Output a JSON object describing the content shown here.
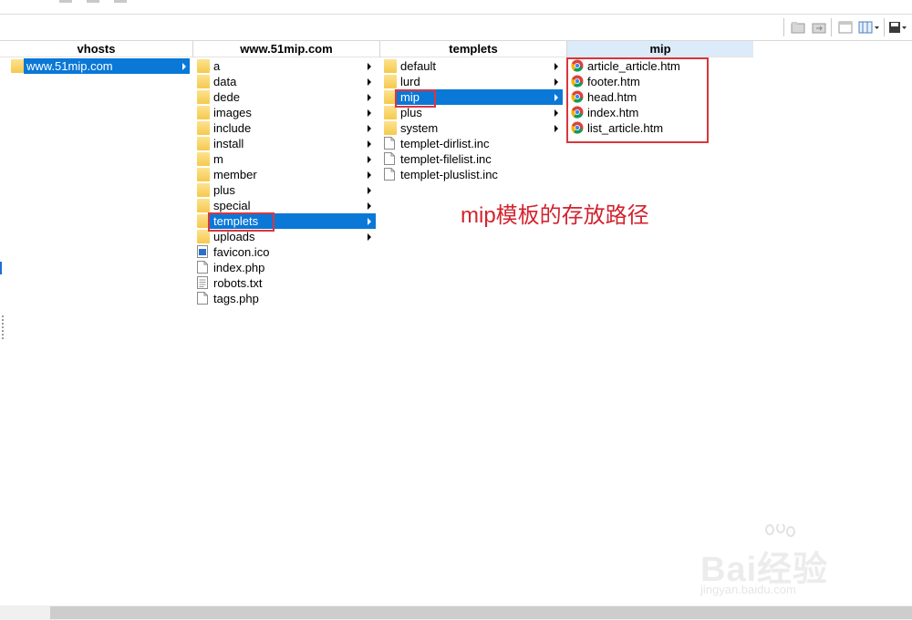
{
  "columns": [
    {
      "header": "vhosts",
      "items": [
        {
          "label": "www.51mip.com",
          "icon": "folder-icon",
          "arrow": true,
          "selected": true
        }
      ]
    },
    {
      "header": "www.51mip.com",
      "items": [
        {
          "label": "a",
          "icon": "folder-icon",
          "arrow": true
        },
        {
          "label": "data",
          "icon": "folder-icon",
          "arrow": true
        },
        {
          "label": "dede",
          "icon": "folder-icon",
          "arrow": true
        },
        {
          "label": "images",
          "icon": "folder-icon",
          "arrow": true
        },
        {
          "label": "include",
          "icon": "folder-icon",
          "arrow": true
        },
        {
          "label": "install",
          "icon": "folder-icon",
          "arrow": true
        },
        {
          "label": "m",
          "icon": "folder-icon",
          "arrow": true
        },
        {
          "label": "member",
          "icon": "folder-icon",
          "arrow": true
        },
        {
          "label": "plus",
          "icon": "folder-icon",
          "arrow": true
        },
        {
          "label": "special",
          "icon": "folder-icon",
          "arrow": true
        },
        {
          "label": "templets",
          "icon": "folder-icon",
          "arrow": true,
          "selected": true
        },
        {
          "label": "uploads",
          "icon": "folder-icon",
          "arrow": true
        },
        {
          "label": "favicon.ico",
          "icon": "image-file-icon",
          "arrow": false
        },
        {
          "label": "index.php",
          "icon": "file-icon",
          "arrow": false
        },
        {
          "label": "robots.txt",
          "icon": "text-file-icon",
          "arrow": false
        },
        {
          "label": "tags.php",
          "icon": "file-icon",
          "arrow": false
        }
      ]
    },
    {
      "header": "templets",
      "items": [
        {
          "label": "default",
          "icon": "folder-icon",
          "arrow": true
        },
        {
          "label": "lurd",
          "icon": "folder-icon",
          "arrow": true
        },
        {
          "label": "mip",
          "icon": "folder-icon",
          "arrow": true,
          "selected": true
        },
        {
          "label": "plus",
          "icon": "folder-icon",
          "arrow": true
        },
        {
          "label": "system",
          "icon": "folder-icon",
          "arrow": true
        },
        {
          "label": "templet-dirlist.inc",
          "icon": "file-icon",
          "arrow": false
        },
        {
          "label": "templet-filelist.inc",
          "icon": "file-icon",
          "arrow": false
        },
        {
          "label": "templet-pluslist.inc",
          "icon": "file-icon",
          "arrow": false
        }
      ]
    },
    {
      "header": "mip",
      "items": [
        {
          "label": "article_article.htm",
          "icon": "chrome-icon",
          "arrow": false
        },
        {
          "label": "footer.htm",
          "icon": "chrome-icon",
          "arrow": false
        },
        {
          "label": "head.htm",
          "icon": "chrome-icon",
          "arrow": false
        },
        {
          "label": "index.htm",
          "icon": "chrome-icon",
          "arrow": false
        },
        {
          "label": "list_article.htm",
          "icon": "chrome-icon",
          "arrow": false
        }
      ]
    }
  ],
  "annotation": "mip模板的存放路径",
  "watermark": {
    "main": "Bai经验",
    "sub": "jingyan.baidu.com"
  },
  "colors": {
    "selection": "#0a78d7",
    "highlight_box": "#d9363e",
    "annotation": "#d2242f",
    "active_header": "#dcebf9"
  }
}
